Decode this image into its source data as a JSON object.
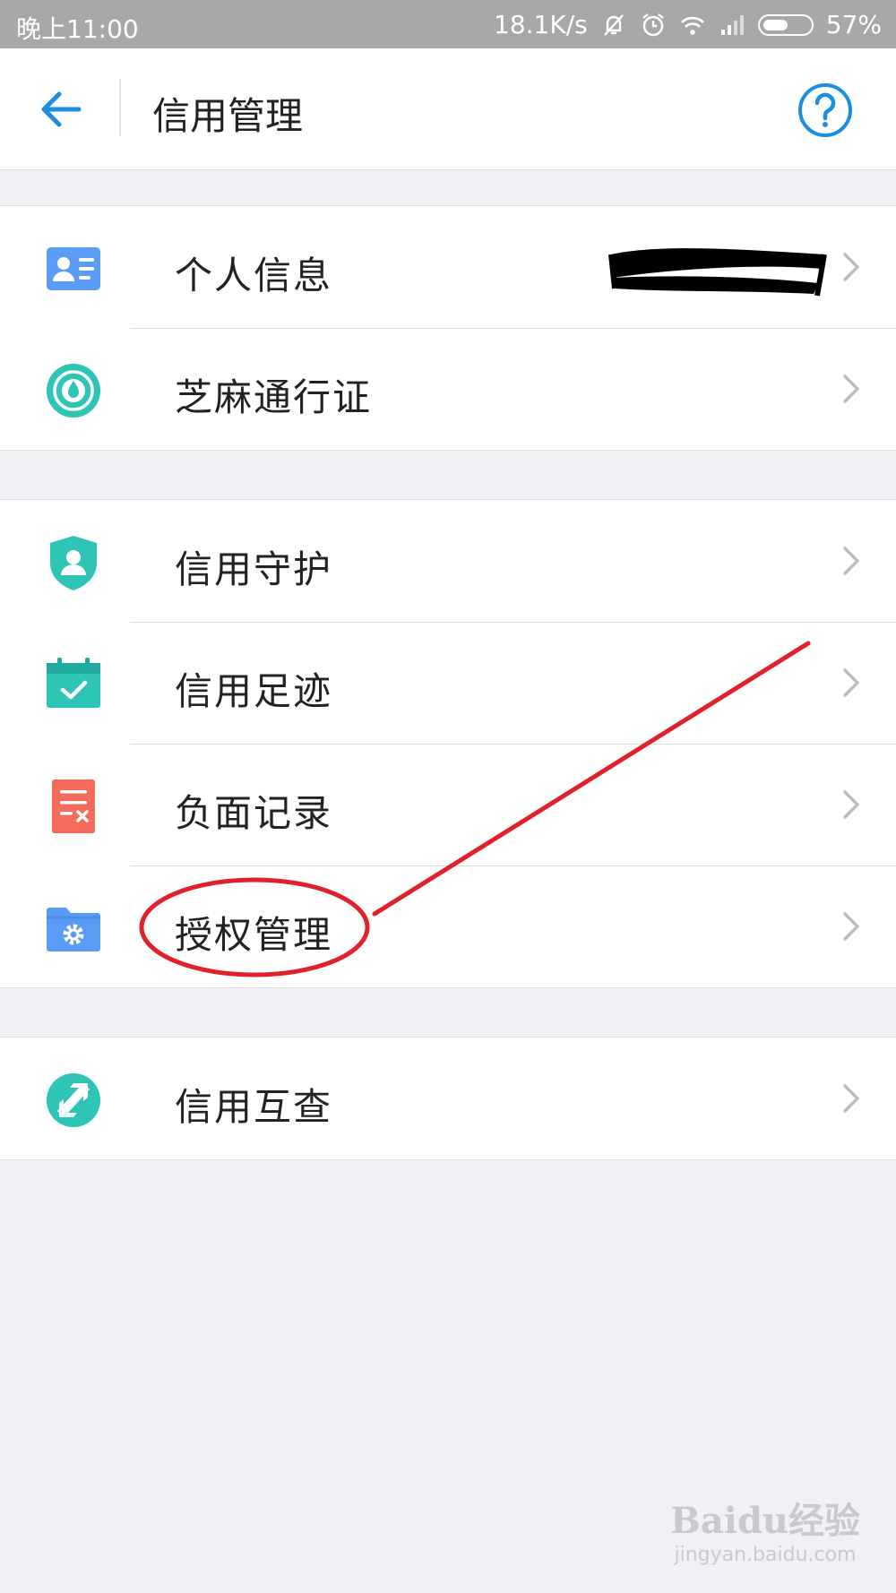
{
  "status_bar": {
    "time": "晚上11:00",
    "speed": "18.1K/s",
    "battery": "57%",
    "battery_level": 0.57,
    "icons": [
      "bell-off-icon",
      "alarm-icon",
      "wifi-icon",
      "signal-icon",
      "battery-icon"
    ]
  },
  "header": {
    "title": "信用管理",
    "back_icon": "arrow-left-icon",
    "help_icon": "question-circle-icon",
    "accent_color": "#1a8ee1"
  },
  "groups": [
    {
      "items": [
        {
          "label": "个人信息",
          "icon": "id-card-icon",
          "color": "#5a9cf5"
        },
        {
          "label": "芝麻通行证",
          "icon": "sesame-passport-icon",
          "color": "#2ec4b6"
        }
      ]
    },
    {
      "items": [
        {
          "label": "信用守护",
          "icon": "shield-user-icon",
          "color": "#2ec4b6"
        },
        {
          "label": "信用足迹",
          "icon": "calendar-check-icon",
          "color": "#2ec4b6"
        },
        {
          "label": "负面记录",
          "icon": "document-x-icon",
          "color": "#f46b5c"
        },
        {
          "label": "授权管理",
          "icon": "folder-gear-icon",
          "color": "#5a9cf5"
        }
      ]
    },
    {
      "items": [
        {
          "label": "信用互查",
          "icon": "mutual-check-icon",
          "color": "#2ec4b6"
        }
      ]
    }
  ],
  "annotation": {
    "color": "#e0202a",
    "highlighted_item": "授权管理"
  },
  "watermark": {
    "main": "Baidu经验",
    "sub": "jingyan.baidu.com"
  }
}
